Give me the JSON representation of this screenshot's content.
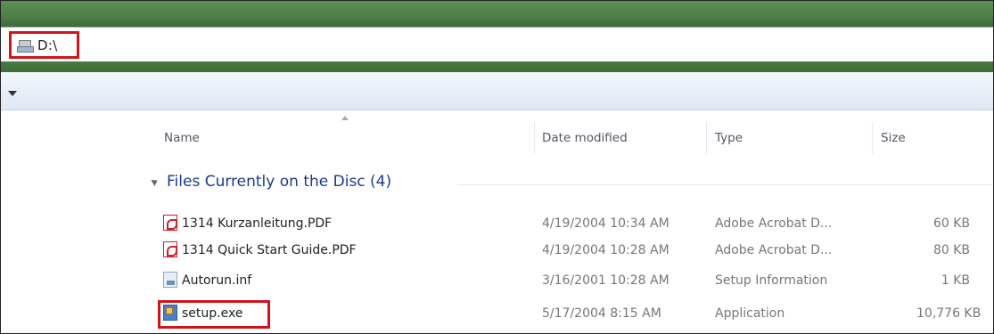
{
  "address_bar": {
    "path": "D:\\"
  },
  "columns": {
    "name": "Name",
    "date": "Date modified",
    "type": "Type",
    "size": "Size"
  },
  "group": {
    "label": "Files Currently on the Disc (4)"
  },
  "files": [
    {
      "name": "1314 Kurzanleitung.PDF",
      "date": "4/19/2004 10:34 AM",
      "type": "Adobe Acrobat D...",
      "size": "60 KB",
      "icon": "pdf-icon"
    },
    {
      "name": "1314 Quick Start Guide.PDF",
      "date": "4/19/2004 10:28 AM",
      "type": "Adobe Acrobat D...",
      "size": "80 KB",
      "icon": "pdf-icon"
    },
    {
      "name": "Autorun.inf",
      "date": "3/16/2001 10:28 AM",
      "type": "Setup Information",
      "size": "1 KB",
      "icon": "setup-info-icon"
    },
    {
      "name": "setup.exe",
      "date": "5/17/2004 8:15 AM",
      "type": "Application",
      "size": "10,776 KB",
      "icon": "application-icon"
    }
  ],
  "highlight_color": "#d1141b"
}
